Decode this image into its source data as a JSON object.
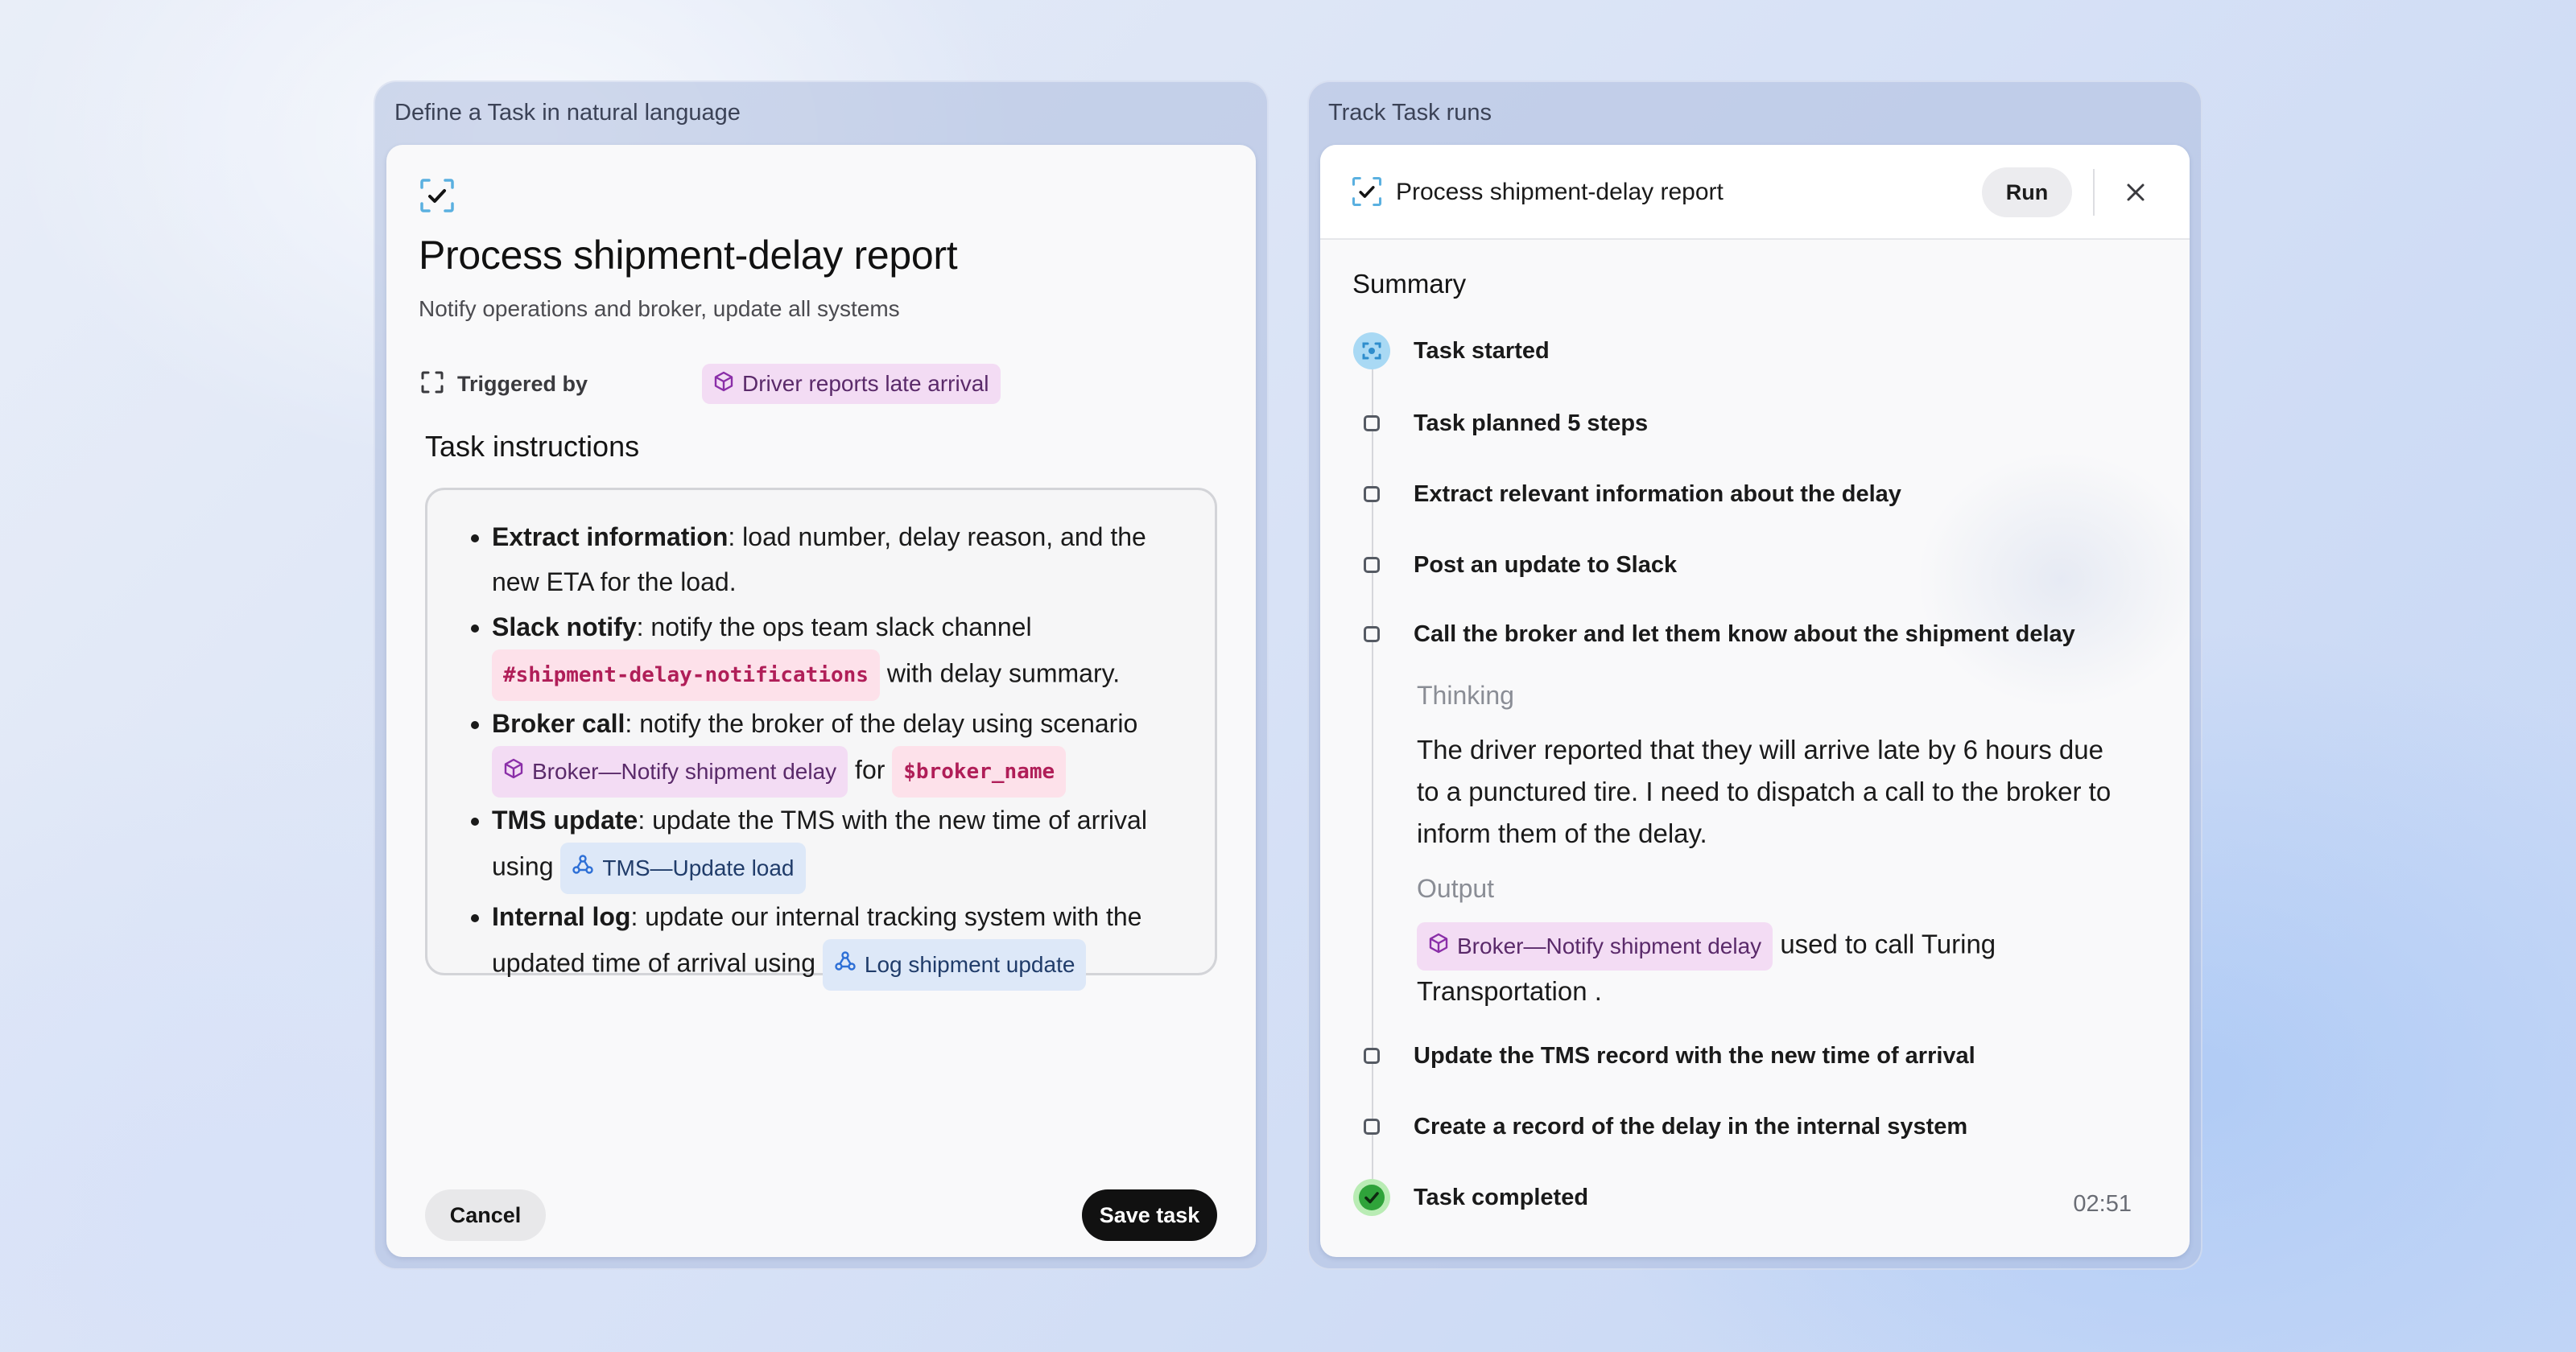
{
  "left_panel": {
    "title": "Define a Task in natural language",
    "task_title": "Process shipment-delay report",
    "task_subtitle": "Notify operations and broker, update all systems",
    "triggered_by_label": "Triggered by",
    "trigger_chip": "Driver reports late arrival",
    "instructions_heading": "Task instructions",
    "instructions": [
      {
        "bold": "Extract information",
        "text": ": load number, delay reason, and the new ETA for the load."
      },
      {
        "bold": "Slack notify",
        "text": ": notify the ops team slack channel",
        "chip_code": "#shipment-delay-notifications",
        "after": " with delay summary."
      },
      {
        "bold": "Broker call",
        "text": ": notify the broker of the delay using scenario",
        "chip": "Broker—Notify shipment delay",
        "mid": "for",
        "chip_code": "$broker_name"
      },
      {
        "bold": "TMS update",
        "text": ": update the TMS with the new time of arrival using",
        "chip": "TMS—Update load"
      },
      {
        "bold": "Internal log",
        "text": ": update our internal tracking system with the updated time of arrival using",
        "chip": "Log shipment update"
      }
    ],
    "cancel_label": "Cancel",
    "save_label": "Save task"
  },
  "right_panel": {
    "title": "Track Task runs",
    "run_title": "Process shipment-delay report",
    "run_button": "Run",
    "summary_label": "Summary",
    "steps": [
      "Task started",
      "Task planned 5 steps",
      "Extract relevant information about the delay",
      "Post an update to Slack",
      "Call the broker and let them know about the shipment delay",
      "Update the TMS record with the new time of arrival",
      "Create a record of the delay in the internal system",
      "Task completed"
    ],
    "thinking_label": "Thinking",
    "thinking_text": "The driver reported that they will arrive late by 6 hours due to a punctured tire. I need to dispatch a call to the broker to inform them of the delay.",
    "output_label": "Output",
    "output_chip": "Broker—Notify shipment delay",
    "output_text": "used to call Turing Transportation .",
    "elapsed": "02:51"
  },
  "colors": {
    "chip_purple_bg": "#f3dcf4",
    "chip_blue_bg": "#dde8f8",
    "chip_code_text": "#b01e58",
    "started_marker": "#5ab8e8",
    "completed_marker": "#2fa33a"
  },
  "icons": [
    "task-check-icon",
    "trigger-frame-icon",
    "cube-icon",
    "webhook-icon",
    "close-icon",
    "spinner-icon",
    "check-circle-icon"
  ]
}
